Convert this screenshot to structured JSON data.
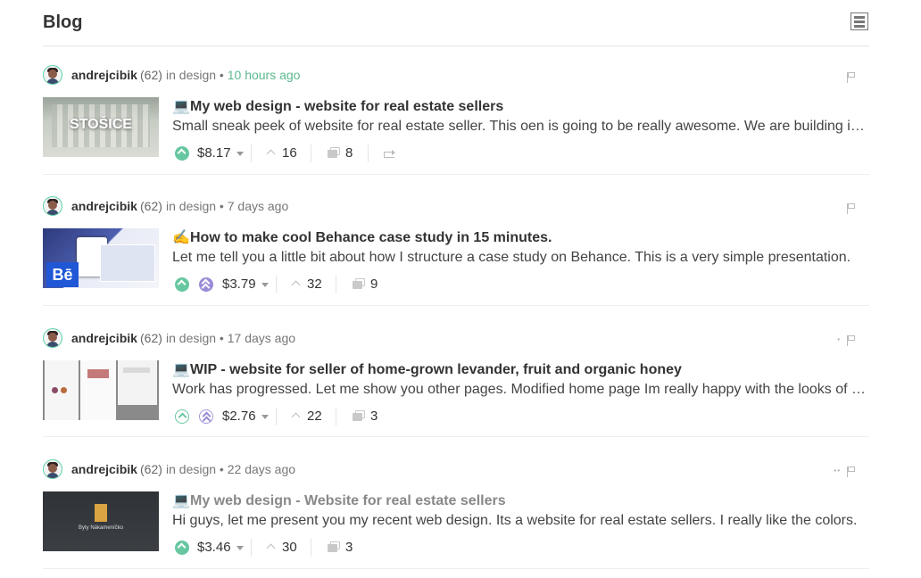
{
  "header": {
    "title": "Blog"
  },
  "colors": {
    "accent_green": "#67c7a0",
    "purple": "#9a8bd6",
    "text": "#333333"
  },
  "posts": [
    {
      "author": "andrejcibik",
      "reputation": "(62)",
      "in_community": "in design",
      "time": "10 hours ago",
      "title_emoji": "💻",
      "title": "My web design - website for real estate sellers",
      "summary": "Small sneak peek of website for real estate seller. This oen is going to be really awesome. We are building it in the Webflow.",
      "payout": "$8.17",
      "votes": "16",
      "comments": "8",
      "thumb_text": "STOŠICE",
      "flag_dots": ""
    },
    {
      "author": "andrejcibik",
      "reputation": "(62)",
      "in_community": "in design",
      "time": "7 days ago",
      "title_emoji": "✍️",
      "title": "How to make cool Behance case study in 15 minutes.",
      "summary": "Let me tell you a little bit about how I structure a case study on Behance. This is a very simple presentation.",
      "payout": "$3.79",
      "votes": "32",
      "comments": "9",
      "thumb_text": "Bē",
      "flag_dots": ""
    },
    {
      "author": "andrejcibik",
      "reputation": "(62)",
      "in_community": "in design",
      "time": "17 days ago",
      "title_emoji": "💻",
      "title": "WIP - website for seller of home-grown levander, fruit and organic honey",
      "summary": "Work has progressed. Let me show you other pages. Modified home page Im really happy with the looks of it now.",
      "payout": "$2.76",
      "votes": "22",
      "comments": "3",
      "thumb_text": "",
      "flag_dots": "•"
    },
    {
      "author": "andrejcibik",
      "reputation": "(62)",
      "in_community": "in design",
      "time": "22 days ago",
      "title_emoji": "💻",
      "title": "My web design - Website for real estate sellers",
      "summary": "Hi guys, let me present you my recent web design. Its a website for real estate sellers. I really like the colors.",
      "payout": "$3.46",
      "votes": "30",
      "comments": "3",
      "thumb_text": "Byty Nákameníčko",
      "flag_dots": "••"
    }
  ]
}
